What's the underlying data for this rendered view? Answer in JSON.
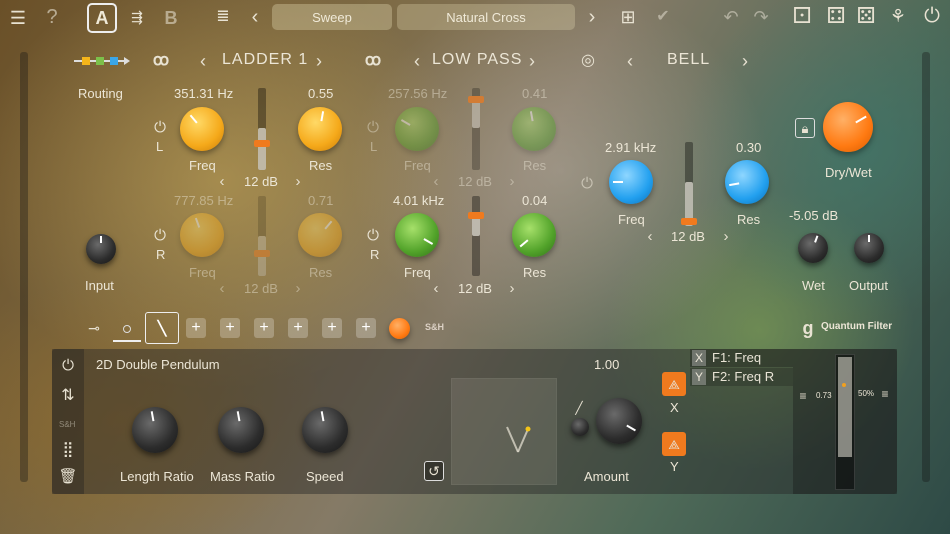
{
  "toolbar": {
    "preset_a": "A",
    "preset_b": "B",
    "prev": "‹",
    "next": "›",
    "sweep_label": "Sweep",
    "preset_name": "Natural Cross"
  },
  "filters": [
    {
      "type": "LADDER 1",
      "prev": "‹",
      "next": "›"
    },
    {
      "type": "LOW PASS",
      "prev": "‹",
      "next": "›"
    },
    {
      "type": "BELL",
      "prev": "‹",
      "next": "›"
    }
  ],
  "routing": {
    "label": "Routing"
  },
  "ladder": {
    "left": {
      "freq_value": "351.31 Hz",
      "freq_label": "Freq",
      "res_value": "0.55",
      "res_label": "Res",
      "channel": "L",
      "slope": "12 dB",
      "prev": "‹",
      "next": "›"
    },
    "right": {
      "freq_value": "777.85 Hz",
      "freq_label": "Freq",
      "res_value": "0.71",
      "res_label": "Res",
      "channel": "R",
      "slope": "12 dB",
      "prev": "‹",
      "next": "›"
    }
  },
  "lowpass": {
    "left": {
      "freq_value": "257.56 Hz",
      "freq_label": "Freq",
      "res_value": "0.41",
      "res_label": "Res",
      "channel": "L",
      "slope": "12 dB",
      "prev": "‹",
      "next": "›"
    },
    "right": {
      "freq_value": "4.01 kHz",
      "freq_label": "Freq",
      "res_value": "0.04",
      "res_label": "Res",
      "channel": "R",
      "slope": "12 dB",
      "prev": "‹",
      "next": "›"
    }
  },
  "bell": {
    "freq_value": "2.91 kHz",
    "freq_label": "Freq",
    "res_value": "0.30",
    "res_label": "Res",
    "slope": "12 dB",
    "prev": "‹",
    "next": "›",
    "gain_value": "-5.05 dB"
  },
  "output": {
    "drywet_label": "Dry/Wet",
    "wet_label": "Wet",
    "output_label": "Output",
    "input_label": "Input"
  },
  "mod_tabs": {
    "sh_label": "S&H"
  },
  "brand": {
    "name": "Quantum Filter"
  },
  "modulator": {
    "title": "2D Double Pendulum",
    "knobs": [
      {
        "label": "Length Ratio"
      },
      {
        "label": "Mass Ratio"
      },
      {
        "label": "Speed"
      }
    ],
    "amount_value": "1.00",
    "amount_label": "Amount",
    "side_sh": "S&H",
    "x_label": "X",
    "y_label": "Y",
    "targets": [
      {
        "axis": "X",
        "name": "F1: Freq"
      },
      {
        "axis": "Y",
        "name": "F2: Freq R"
      }
    ],
    "meter_left": "0.73",
    "meter_right": "50%"
  }
}
